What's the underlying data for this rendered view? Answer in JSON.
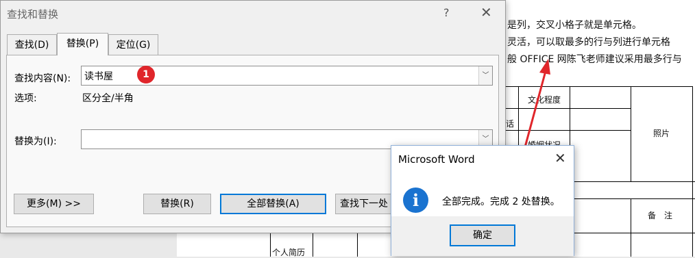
{
  "document": {
    "lines": [
      "是列，交叉小格子就是单元格。",
      "灵活，可以取最多的行与列进行单元格",
      "般 OFFICE 网陈飞老师建议采用最多行与"
    ],
    "cells": [
      "文化程度",
      "话",
      "照片",
      "婚姻状况",
      "备　注",
      "个人简历"
    ]
  },
  "find_replace": {
    "title": "查找和替换",
    "help": "?",
    "close": "✕",
    "tabs": [
      "查找(D)",
      "替换(P)",
      "定位(G)"
    ],
    "find_label": "查找内容(N):",
    "find_value": "读书屋",
    "options_label": "选项:",
    "options_value": "区分全/半角",
    "replace_label": "替换为(I):",
    "replace_value": "",
    "badge": "1",
    "buttons": {
      "more": "更多(M) >>",
      "replace": "替换(R)",
      "replace_all": "全部替换(A)",
      "find_next": "查找下一处"
    }
  },
  "message_box": {
    "title": "Microsoft Word",
    "close": "✕",
    "icon": "info-icon",
    "text": "全部完成。完成 2 处替换。",
    "ok": "确定"
  },
  "colors": {
    "accent": "#0078d7",
    "badge": "#e0262b",
    "info": "#1a73d0",
    "arrow": "#e0262b"
  }
}
